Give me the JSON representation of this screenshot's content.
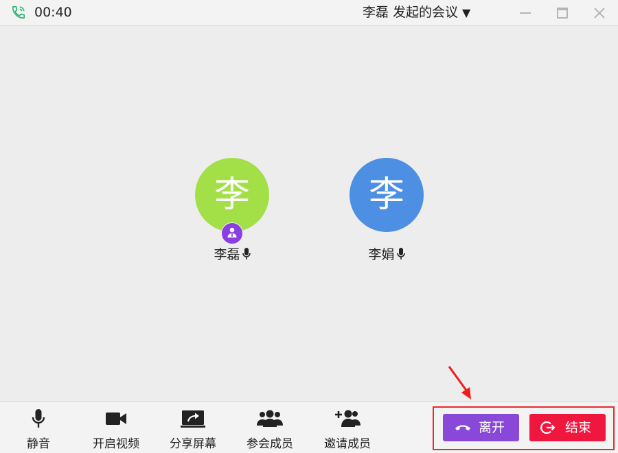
{
  "titlebar": {
    "timer": "00:40",
    "meeting_title": "李磊 发起的会议",
    "caret": "▼"
  },
  "participants": [
    {
      "avatar_char": "李",
      "name": "李磊",
      "avatar_color": "#a3e048",
      "is_host": true,
      "mic_on": true
    },
    {
      "avatar_char": "李",
      "name": "李娟",
      "avatar_color": "#4d8fe2",
      "is_host": false,
      "mic_on": true
    }
  ],
  "toolbar": {
    "mute_label": "静音",
    "video_label": "开启视频",
    "share_label": "分享屏幕",
    "members_label": "参会成员",
    "invite_label": "邀请成员",
    "leave_label": "离开",
    "end_label": "结束"
  },
  "colors": {
    "leave_button": "#8a48d8",
    "end_button": "#f0173f",
    "host_badge": "#8b3fe0",
    "highlight": "#e82a2a",
    "call_icon": "#2bb673"
  },
  "icons": {
    "call": "phone-call-icon",
    "minimize": "minimize-icon",
    "maximize": "maximize-icon",
    "close": "close-icon",
    "mute": "microphone-icon",
    "video": "video-camera-icon",
    "share": "share-screen-icon",
    "members": "group-icon",
    "invite": "add-user-icon",
    "leave": "hang-up-icon",
    "end": "exit-icon"
  }
}
